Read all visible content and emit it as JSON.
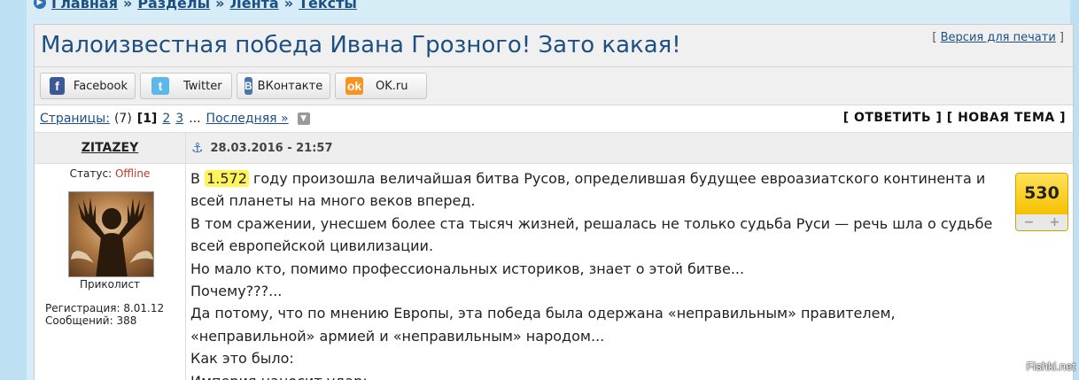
{
  "breadcrumb": {
    "items": [
      "Главная",
      "Разделы",
      "Лента",
      "Тексты"
    ],
    "separator": "»"
  },
  "title": "Малоизвестная победа Ивана Грозного! Зато какая!",
  "print_link": {
    "open": "[",
    "label": "Версия для печати",
    "close": "]"
  },
  "share": [
    {
      "icon": "facebook-icon",
      "glyph": "f",
      "label": "Facebook"
    },
    {
      "icon": "twitter-icon",
      "glyph": "t",
      "label": "Twitter"
    },
    {
      "icon": "vkontakte-icon",
      "glyph": "B",
      "label": "ВКонтакте"
    },
    {
      "icon": "ok-icon",
      "glyph": "ok",
      "label": "OK.ru"
    }
  ],
  "pagination": {
    "label": "Страницы:",
    "count": "(7)",
    "current": "[1]",
    "pages": [
      "2",
      "3"
    ],
    "ellipsis": "...",
    "last": "Последняя »"
  },
  "actions": {
    "reply": "[ ОТВЕТИТЬ ]",
    "new_topic": "[ НОВАЯ ТЕМА ]"
  },
  "post": {
    "author": "ZITAZEY",
    "date": "28.03.2016 - 21:57",
    "status_label": "Статус:",
    "status_value": "Offline",
    "rank": "Приколист",
    "registration": "Регистрация: 8.01.12",
    "messages": "Сообщений: 388",
    "score": "530",
    "vote_down": "−",
    "vote_up": "+",
    "lines": {
      "l1_pre": "В ",
      "l1_highlight": "1.572",
      "l1_post": " году произошла величайшая битва Русов, определившая будущее евроазиатского континента и всей планеты на много веков вперед.",
      "l2": "В том сражении, унесшем более ста тысяч жизней, решалась не только судьба Руси — речь шла о судьбе всей европейской цивилизации.",
      "l3": "Но мало кто, помимо профессиональных историков, знает о этой битве...",
      "l4": "Почему???...",
      "l5": "Да потому, что по мнению Европы, эта победа была одержана «неправильным» правителем, «неправильной» армией и «неправильным» народом...",
      "l6": "Как это было:",
      "l7": "Империя наносит удар:"
    }
  },
  "watermark": "Fishki.net",
  "colors": {
    "link": "#1d4f84",
    "offline": "#c0392b",
    "score_bg": "#ffd21a",
    "highlight": "#fff45a"
  }
}
